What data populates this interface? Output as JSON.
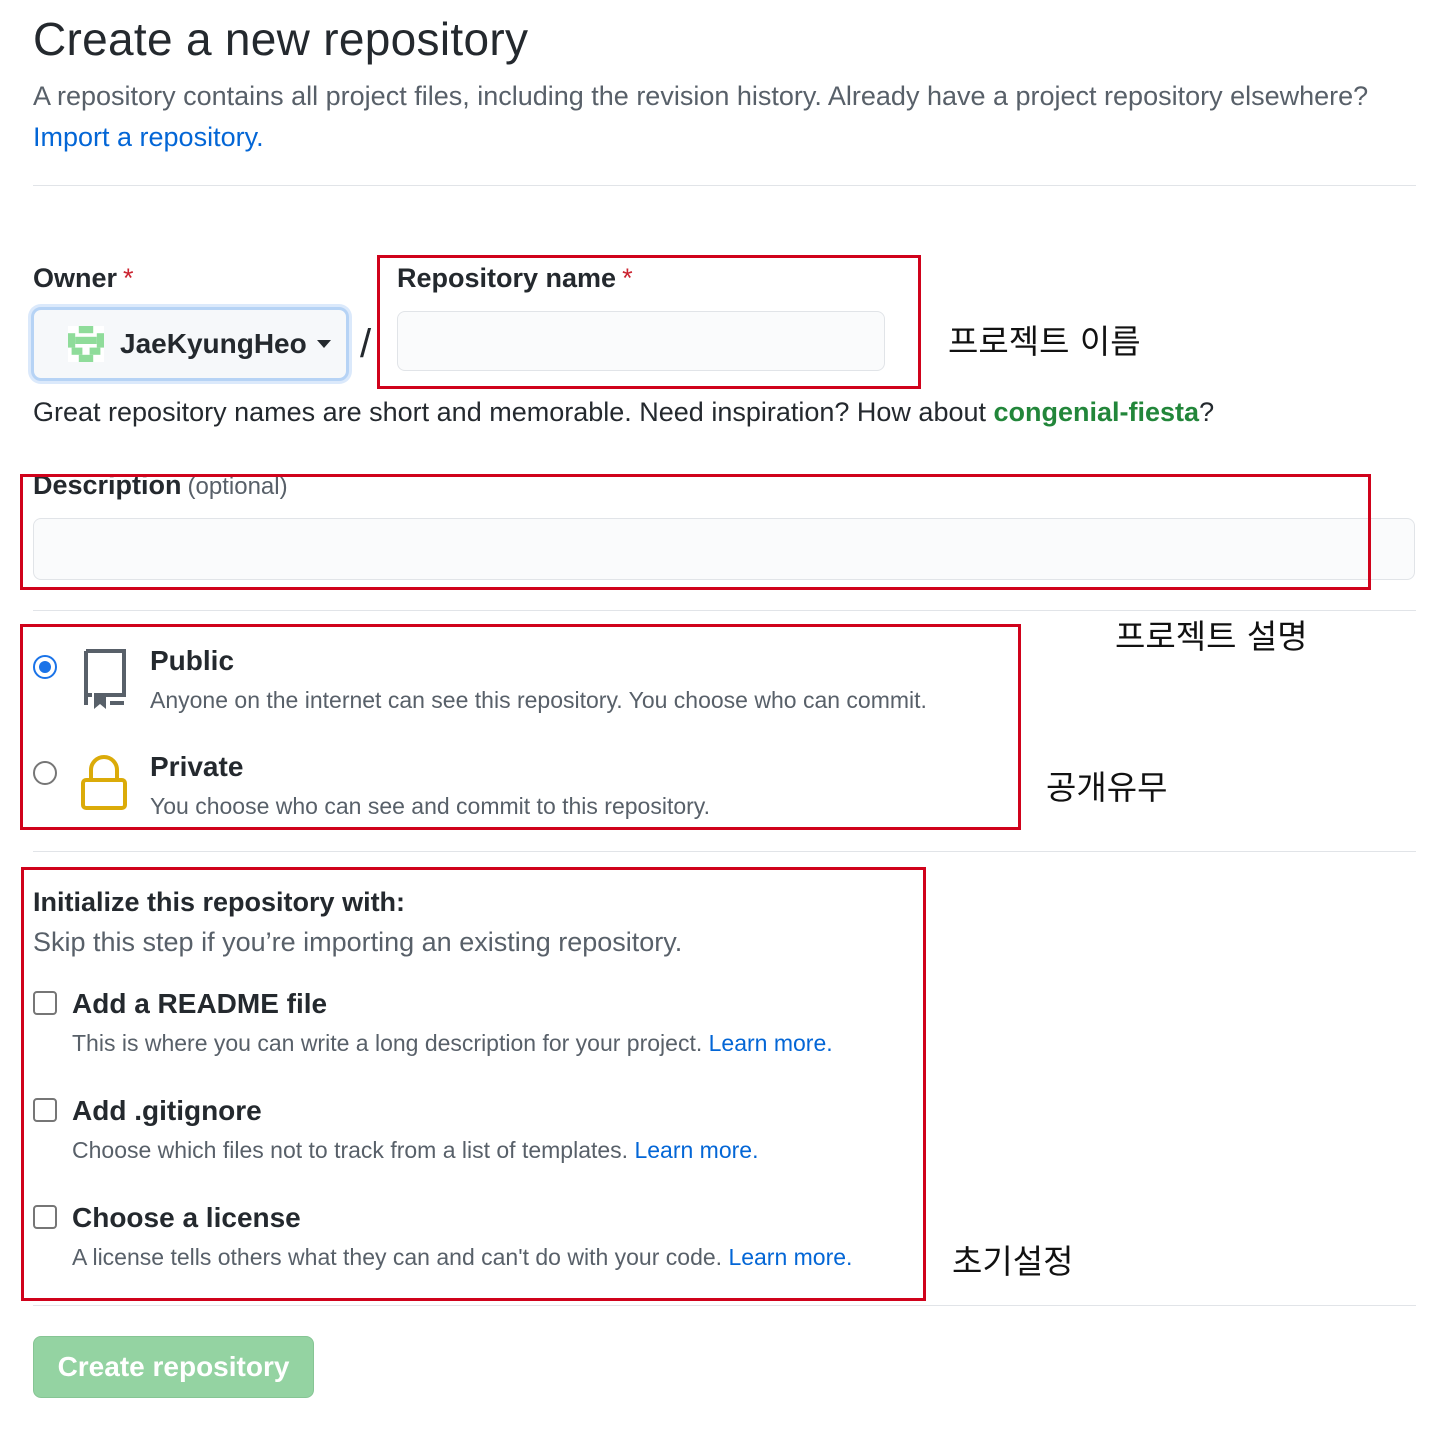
{
  "header": {
    "title": "Create a new repository",
    "subtitle": "A repository contains all project files, including the revision history. Already have a project repository elsewhere?",
    "import_link": "Import a repository."
  },
  "owner": {
    "label": "Owner",
    "required_mark": "*",
    "value": "JaeKyungHeo"
  },
  "separator": "/",
  "repo_name": {
    "label": "Repository name",
    "required_mark": "*",
    "value": ""
  },
  "name_hint": {
    "text": "Great repository names are short and memorable. Need inspiration? How about",
    "suggestion": "congenial-fiesta",
    "end": "?"
  },
  "description": {
    "label": "Description",
    "optional": "(optional)",
    "value": ""
  },
  "visibility": {
    "public": {
      "title": "Public",
      "desc": "Anyone on the internet can see this repository. You choose who can commit.",
      "selected": true
    },
    "private": {
      "title": "Private",
      "desc": "You choose who can see and commit to this repository.",
      "selected": false
    }
  },
  "init": {
    "title": "Initialize this repository with:",
    "subtitle": "Skip this step if you’re importing an existing repository.",
    "options": [
      {
        "title": "Add a README file",
        "desc": "This is where you can write a long description for your project.",
        "link": "Learn more."
      },
      {
        "title": "Add .gitignore",
        "desc": "Choose which files not to track from a list of templates.",
        "link": "Learn more."
      },
      {
        "title": "Choose a license",
        "desc": "A license tells others what they can and can't do with your code.",
        "link": "Learn more."
      }
    ]
  },
  "submit_label": "Create repository",
  "annotations": {
    "repo_name": "프로젝트 이름",
    "description": "프로젝트 설명",
    "visibility": "공개유무",
    "init": "초기설정"
  },
  "colors": {
    "annotation_box": "#d0021b",
    "link": "#0366d6",
    "suggestion": "#22863a",
    "create_button": "#94d3a2",
    "radio_selected": "#1a73e8"
  },
  "icons": {
    "owner_avatar": "identicon-avatar",
    "public": "repo-book-icon",
    "private": "lock-icon",
    "caret": "caret-down-icon"
  }
}
